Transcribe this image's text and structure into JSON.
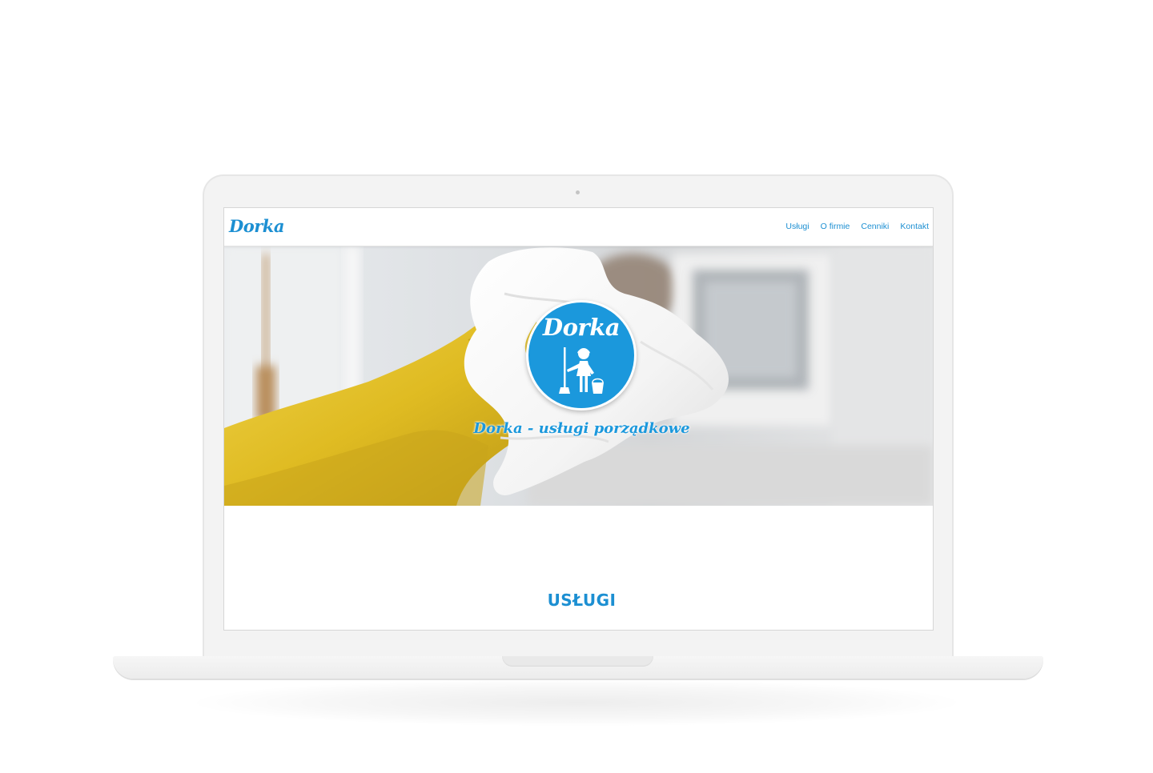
{
  "site": {
    "brand": "Dorka",
    "nav": [
      {
        "label": "Usługi"
      },
      {
        "label": "O firmie"
      },
      {
        "label": "Cenniki"
      },
      {
        "label": "Kontakt"
      }
    ]
  },
  "hero": {
    "emblem_text": "Dorka",
    "emblem_icon": "cleaning-lady-icon",
    "tagline": "Dorka - usługi porządkowe"
  },
  "section": {
    "title": "USŁUGI"
  },
  "colors": {
    "accent": "#1c8fd2",
    "emblem": "#1b98dc",
    "glove": "#e3c12b"
  }
}
